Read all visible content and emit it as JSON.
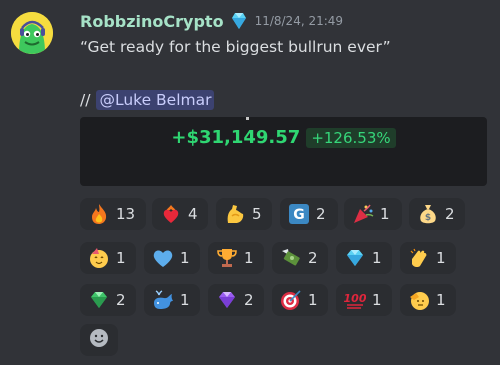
{
  "message": {
    "username": "RobbzinoCrypto",
    "badge_icon": "diamond-icon",
    "timestamp": "11/8/24, 21:49",
    "line1": "“Get ready for the biggest bullrun ever”",
    "line2_prefix": "//",
    "mention": "@Luke Belmar"
  },
  "embed": {
    "pnl_value": "+$31,149.57",
    "pnl_percent": "+126.53%",
    "positive_color": "#2fd672"
  },
  "reactions": [
    {
      "emoji": "fire-icon",
      "count": "13"
    },
    {
      "emoji": "heart-on-fire-icon",
      "count": "4"
    },
    {
      "emoji": "flexed-biceps-icon",
      "count": "5"
    },
    {
      "emoji": "letter-g-icon",
      "count": "2"
    },
    {
      "emoji": "party-popper-icon",
      "count": "1"
    },
    {
      "emoji": "money-bag-icon",
      "count": "2"
    },
    {
      "emoji": "partying-face-icon",
      "count": "1"
    },
    {
      "emoji": "blue-heart-icon",
      "count": "1"
    },
    {
      "emoji": "trophy-icon",
      "count": "1"
    },
    {
      "emoji": "money-with-wings-icon",
      "count": "2"
    },
    {
      "emoji": "gem-icon",
      "count": "1"
    },
    {
      "emoji": "clapping-hands-icon",
      "count": "1"
    },
    {
      "emoji": "green-gem-icon",
      "count": "2"
    },
    {
      "emoji": "whale-icon",
      "count": "1"
    },
    {
      "emoji": "purple-gem-icon",
      "count": "2"
    },
    {
      "emoji": "direct-hit-icon",
      "count": "1"
    },
    {
      "emoji": "hundred-points-icon",
      "count": "1"
    },
    {
      "emoji": "saluting-face-icon",
      "count": "1"
    }
  ],
  "add_reaction_icon": "add-reaction-smiley-icon"
}
